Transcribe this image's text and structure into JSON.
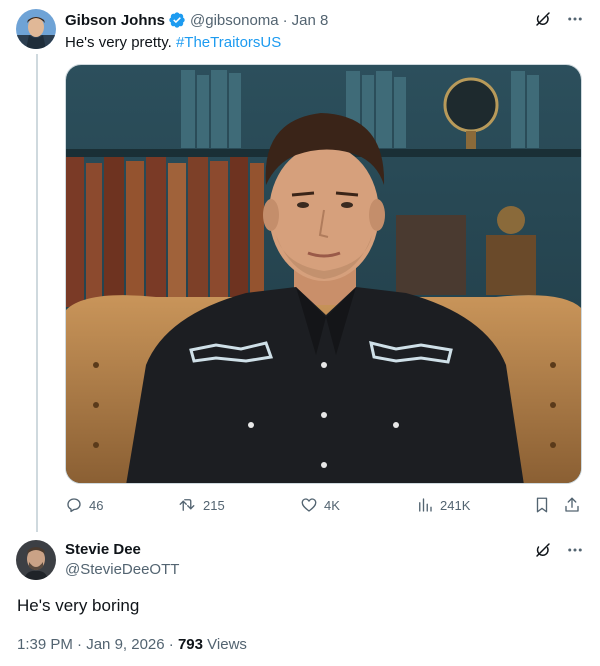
{
  "tweet": {
    "author_name": "Gibson Johns",
    "handle": "@gibsonoma",
    "separator": "·",
    "date": "Jan 8",
    "text": "He's very pretty.",
    "hashtag": "#TheTraitorsUS",
    "stats": {
      "replies": "46",
      "reposts": "215",
      "likes": "4K",
      "views": "241K"
    },
    "verified_color": "#1d9bf0"
  },
  "reply": {
    "author_name": "Stevie Dee",
    "handle": "@StevieDeeOTT",
    "text": "He's very boring",
    "time": "1:39 PM",
    "separator1": "·",
    "date": "Jan 9, 2026",
    "separator2": "·",
    "views_count": "793",
    "views_label": "Views"
  },
  "icons": {
    "grok": "grok-icon",
    "more": "more-icon",
    "reply": "reply-icon",
    "repost": "repost-icon",
    "like": "heart-icon",
    "views": "views-icon",
    "bookmark": "bookmark-icon",
    "share": "share-icon"
  },
  "colors": {
    "text": "#0f1419",
    "secondary": "#536471",
    "link": "#1d9bf0",
    "thread_line": "#cfd9de"
  }
}
